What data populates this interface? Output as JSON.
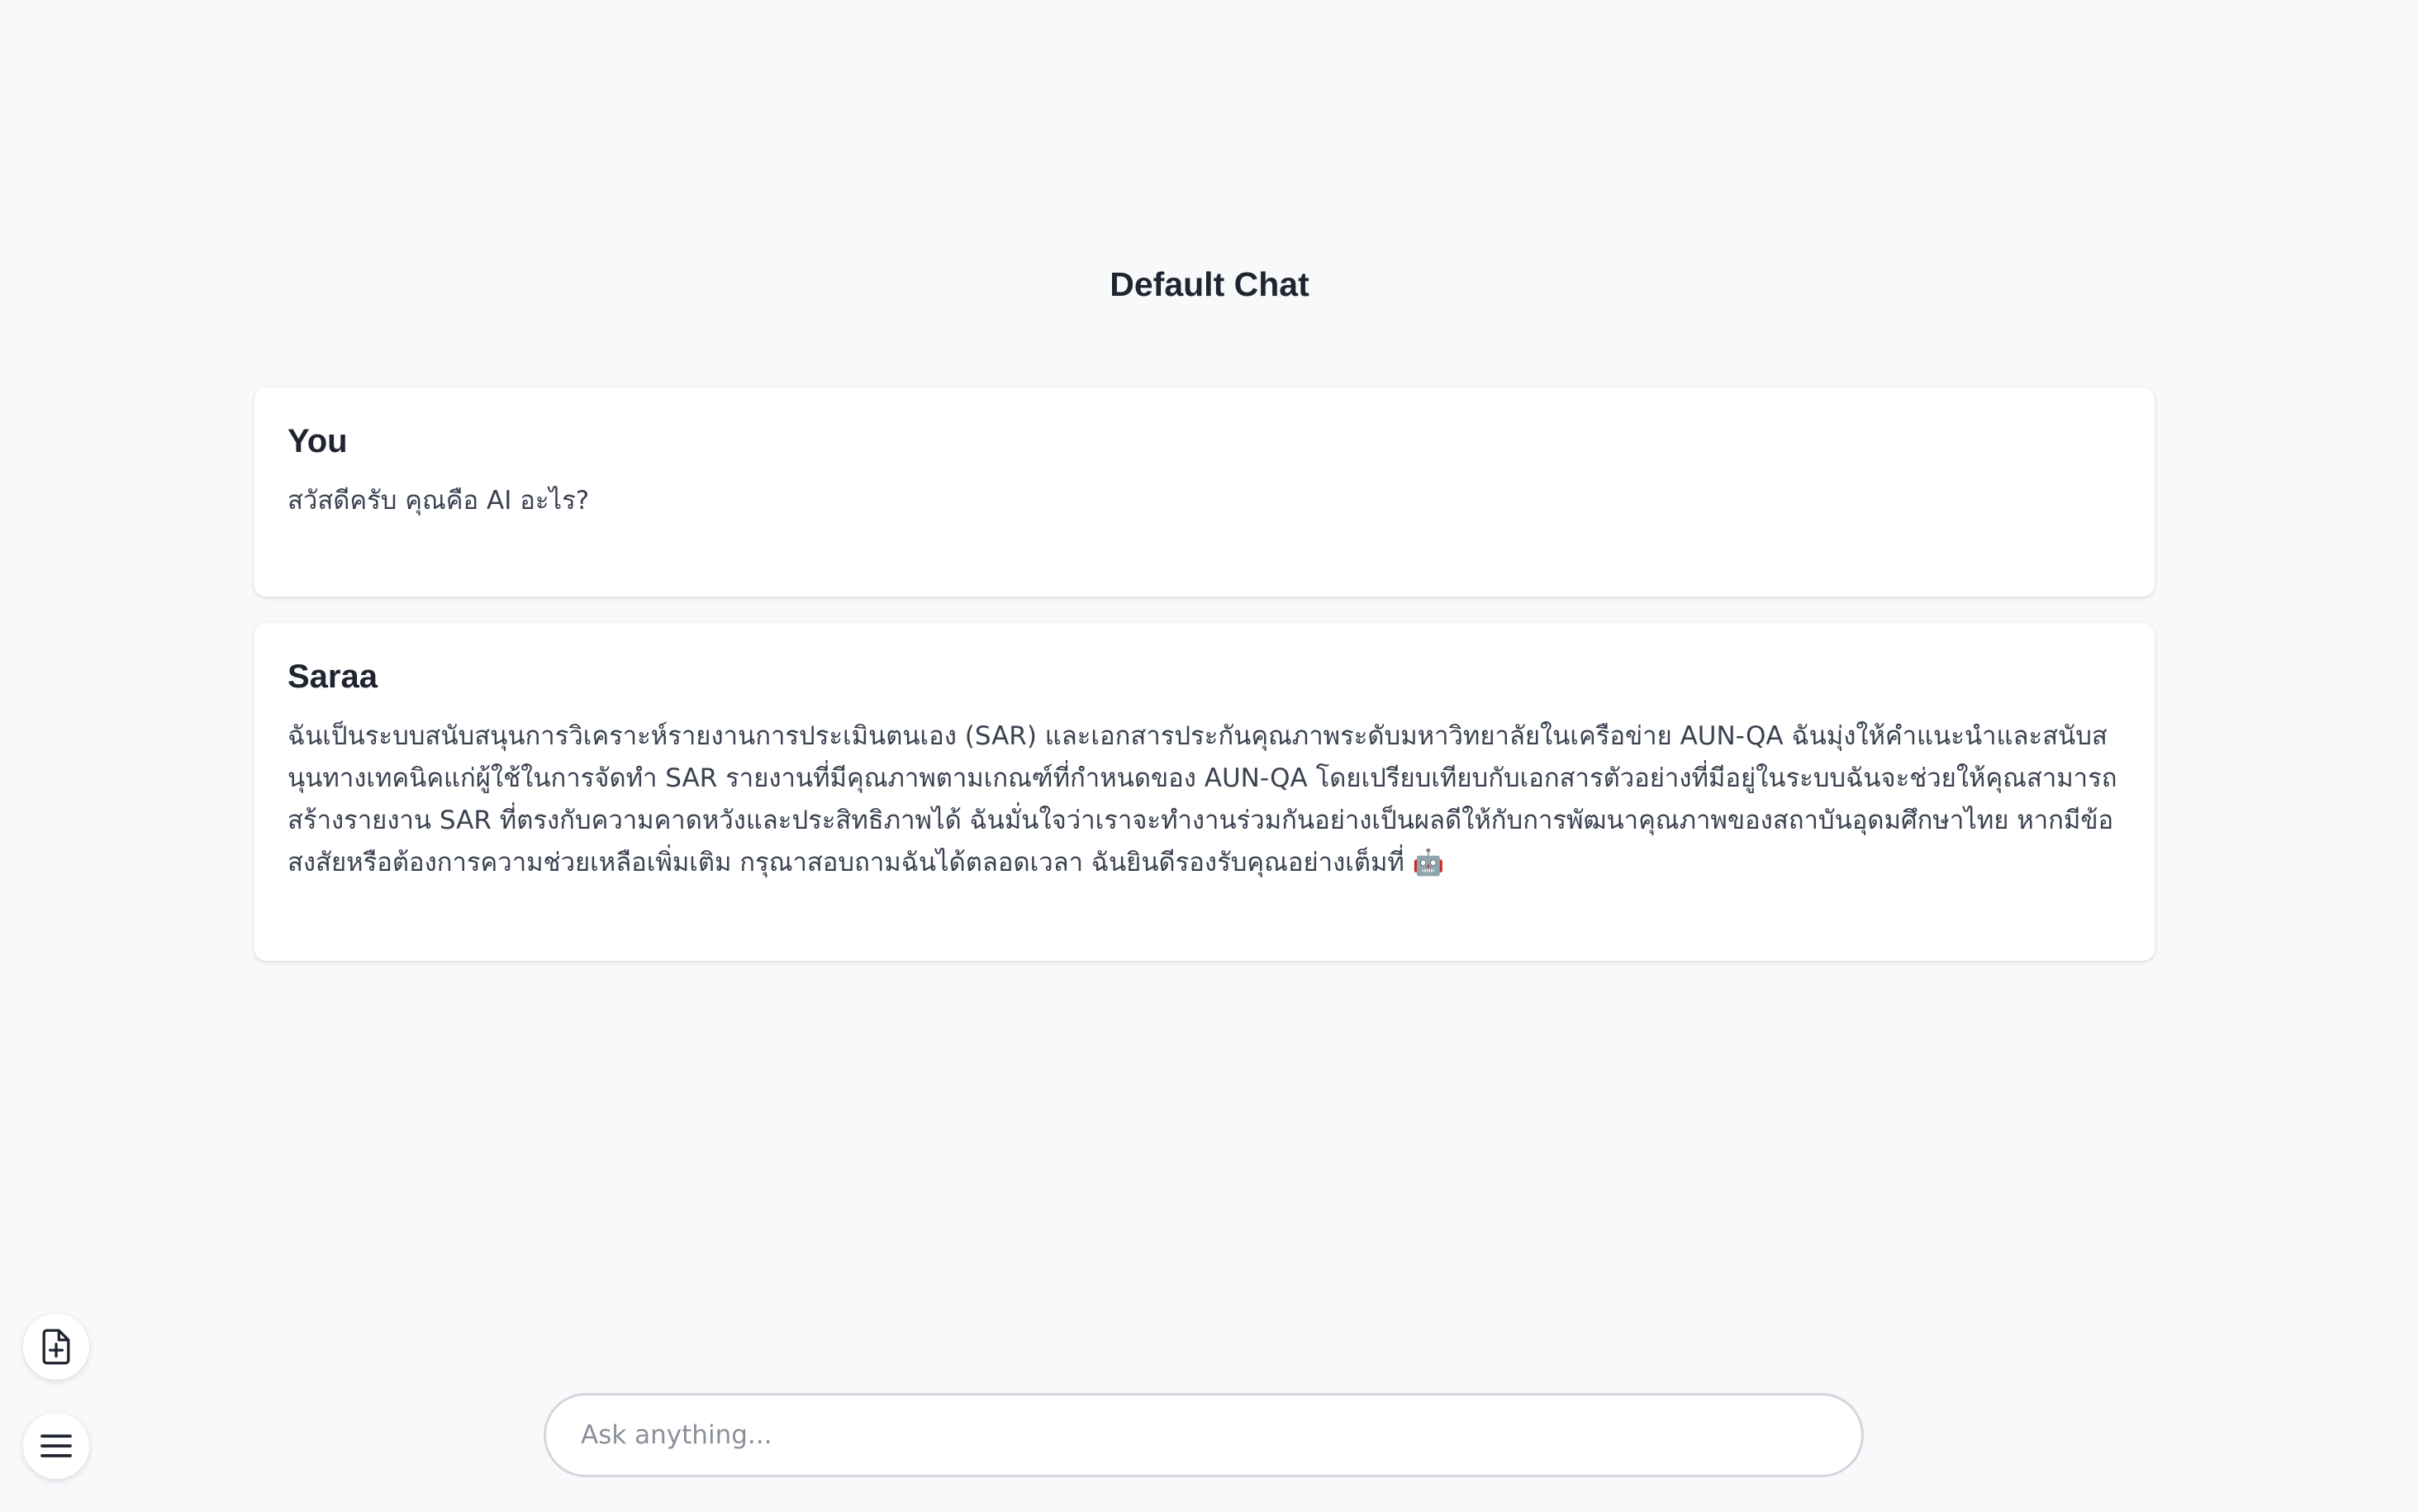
{
  "chat": {
    "title": "Default Chat"
  },
  "messages": [
    {
      "author": "You",
      "text": "สวัสดีครับ คุณคือ AI อะไร?"
    },
    {
      "author": "Saraa",
      "text": "ฉันเป็นระบบสนับสนุนการวิเคราะห์รายงานการประเมินตนเอง (SAR) และเอกสารประกันคุณภาพระดับมหาวิทยาลัยในเครือข่าย AUN-QA ฉันมุ่งให้คำแนะนำและสนับสนุนทางเทคนิคแก่ผู้ใช้ในการจัดทำ SAR รายงานที่มีคุณภาพตามเกณฑ์ที่กำหนดของ AUN-QA โดยเปรียบเทียบกับเอกสารตัวอย่างที่มีอยู่ในระบบฉันจะช่วยให้คุณสามารถสร้างรายงาน SAR ที่ตรงกับความคาดหวังและประสิทธิภาพได้ ฉันมั่นใจว่าเราจะทำงานร่วมกันอย่างเป็นผลดีให้กับการพัฒนาคุณภาพของสถาบันอุดมศึกษาไทย หากมีข้อสงสัยหรือต้องการความช่วยเหลือเพิ่มเติม กรุณาสอบถามฉันได้ตลอดเวลา ฉันยินดีรองรับคุณอย่างเต็มที่ 🤖"
    }
  ],
  "composer": {
    "placeholder": "Ask anything..."
  },
  "icons": {
    "new_document": "file-plus-icon",
    "menu": "hamburger-menu-icon"
  }
}
